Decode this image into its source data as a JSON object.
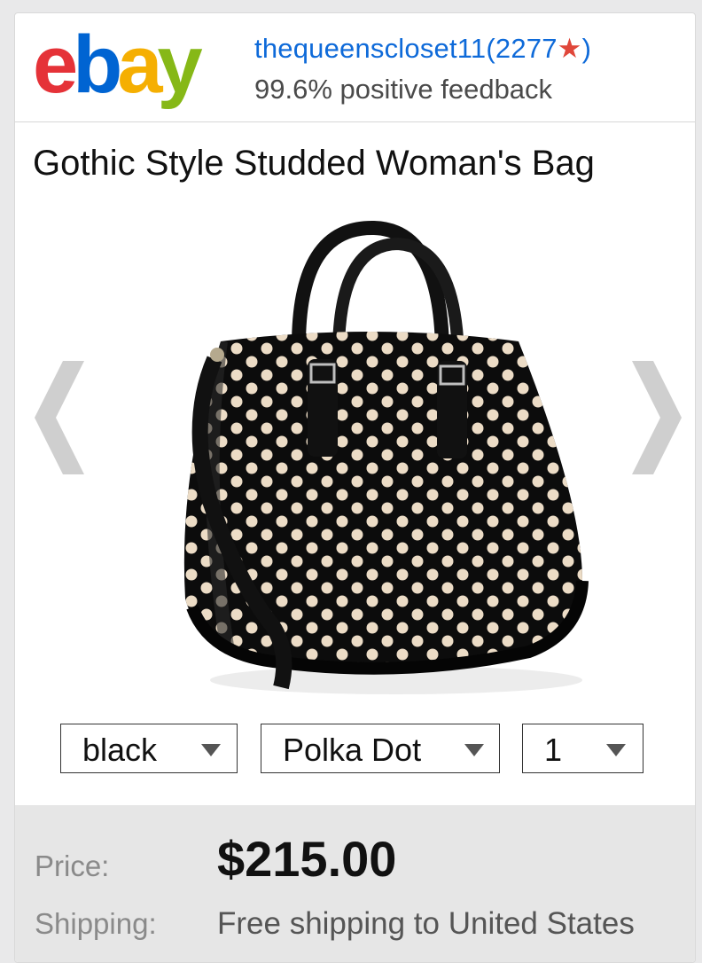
{
  "brand": {
    "logo_text": "ebay",
    "logo_colors": [
      "#e53238",
      "#0064d2",
      "#f5af02",
      "#86b817"
    ]
  },
  "seller": {
    "name": "thequeenscloset11",
    "score_prefix": "(2277",
    "star": "★",
    "score_suffix": ")",
    "feedback": "99.6% positive feedback"
  },
  "listing": {
    "title": "Gothic Style Studded Woman's Bag",
    "image": "black patent polka dot handbag"
  },
  "carousel": {
    "prev_icon": "chevron-left-icon",
    "next_icon": "chevron-right-icon"
  },
  "options": {
    "color": "black",
    "pattern": "Polka Dot",
    "quantity": "1"
  },
  "pricing": {
    "price_label": "Price:",
    "price": "$215.00",
    "shipping_label": "Shipping:",
    "shipping": "Free shipping to United States"
  },
  "colors": {
    "link": "#0e6ad9",
    "star": "#e0473a",
    "panel": "#e6e6e6"
  }
}
